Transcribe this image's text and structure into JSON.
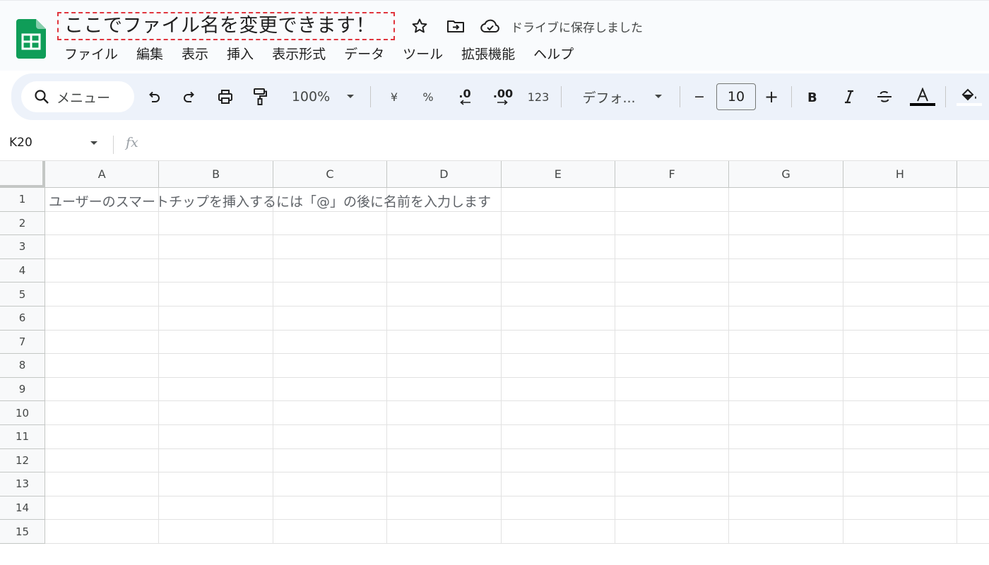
{
  "document": {
    "title": "ここでファイル名を変更できます！",
    "save_status": "ドライブに保存しました"
  },
  "icons": {
    "app_logo": "sheets-logo-icon",
    "star": "star-icon",
    "move": "folder-move-icon",
    "cloud": "cloud-check-icon",
    "search": "search-icon",
    "undo": "undo-icon",
    "redo": "redo-icon",
    "print": "print-icon",
    "paint_format": "paint-format-icon",
    "fill": "fill-color-icon",
    "bold": "bold-icon",
    "italic": "italic-icon",
    "strikethrough": "strikethrough-icon",
    "text_color": "text-color-icon"
  },
  "colors": {
    "accent_red_dashed": "#e0353e",
    "sheets_green": "#0f9d58",
    "toolbar_bg": "#edf2fa"
  },
  "menu": [
    "ファイル",
    "編集",
    "表示",
    "挿入",
    "表示形式",
    "データ",
    "ツール",
    "拡張機能",
    "ヘルプ"
  ],
  "toolbar": {
    "search_label": "メニュー",
    "zoom": "100%",
    "currency": "¥",
    "percent": "%",
    "decrease_decimal": ".0",
    "increase_decimal": ".00",
    "number_format": "123",
    "font_name": "デフォ...",
    "font_size": "10",
    "minus": "−",
    "plus": "+"
  },
  "formula_bar": {
    "name_box": "K20",
    "fx": "fx"
  },
  "grid": {
    "columns": [
      "A",
      "B",
      "C",
      "D",
      "E",
      "F",
      "G",
      "H"
    ],
    "rows": [
      "1",
      "2",
      "3",
      "4",
      "5",
      "6",
      "7",
      "8",
      "9",
      "10",
      "11",
      "12",
      "13",
      "14",
      "15"
    ],
    "cell_a1": "ユーザーのスマートチップを挿入するには「@」の後に名前を入力します"
  }
}
